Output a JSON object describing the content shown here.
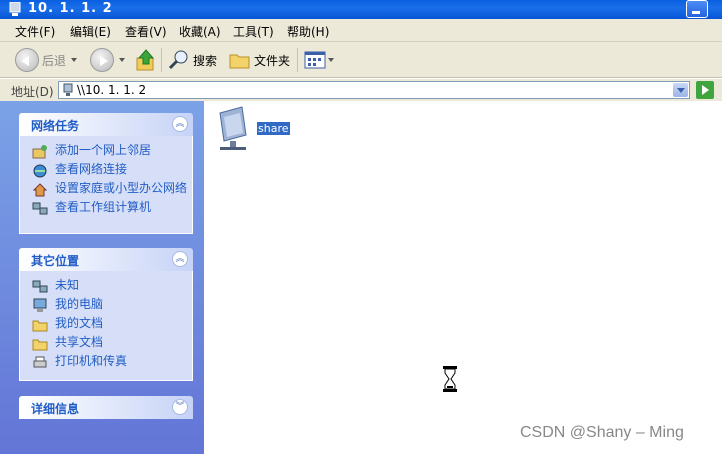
{
  "window": {
    "title": "10. 1. 1. 2"
  },
  "menu": [
    {
      "label": "文件(F)"
    },
    {
      "label": "编辑(E)"
    },
    {
      "label": "查看(V)"
    },
    {
      "label": "收藏(A)"
    },
    {
      "label": "工具(T)"
    },
    {
      "label": "帮助(H)"
    }
  ],
  "toolbar": {
    "back_label": "后退",
    "search_label": "搜索",
    "folders_label": "文件夹"
  },
  "address": {
    "label": "地址(D)",
    "value": "\\\\10. 1. 1. 2"
  },
  "taskpane": {
    "network_tasks": {
      "title": "网络任务",
      "items": [
        {
          "label": "添加一个网上邻居",
          "icon": "add-network-place-icon"
        },
        {
          "label": "查看网络连接",
          "icon": "network-connections-icon"
        },
        {
          "label": "设置家庭或小型办公网络",
          "icon": "home-network-icon"
        },
        {
          "label": "查看工作组计算机",
          "icon": "workgroup-computers-icon"
        }
      ]
    },
    "other_places": {
      "title": "其它位置",
      "items": [
        {
          "label": "未知",
          "icon": "network-icon"
        },
        {
          "label": "我的电脑",
          "icon": "my-computer-icon"
        },
        {
          "label": "我的文档",
          "icon": "my-documents-icon"
        },
        {
          "label": "共享文档",
          "icon": "shared-documents-icon"
        },
        {
          "label": "打印机和传真",
          "icon": "printer-icon"
        }
      ]
    },
    "details": {
      "title": "详细信息"
    }
  },
  "content": {
    "items": [
      {
        "label": "share",
        "icon": "network-share-icon",
        "selected": true
      }
    ]
  },
  "watermark": "CSDN @Shany – Ming",
  "colors": {
    "titlebar": "#0a5fe0",
    "taskpane_bg": "#7ba2e7",
    "panel_title": "#215dc6",
    "selection": "#316ac5"
  }
}
